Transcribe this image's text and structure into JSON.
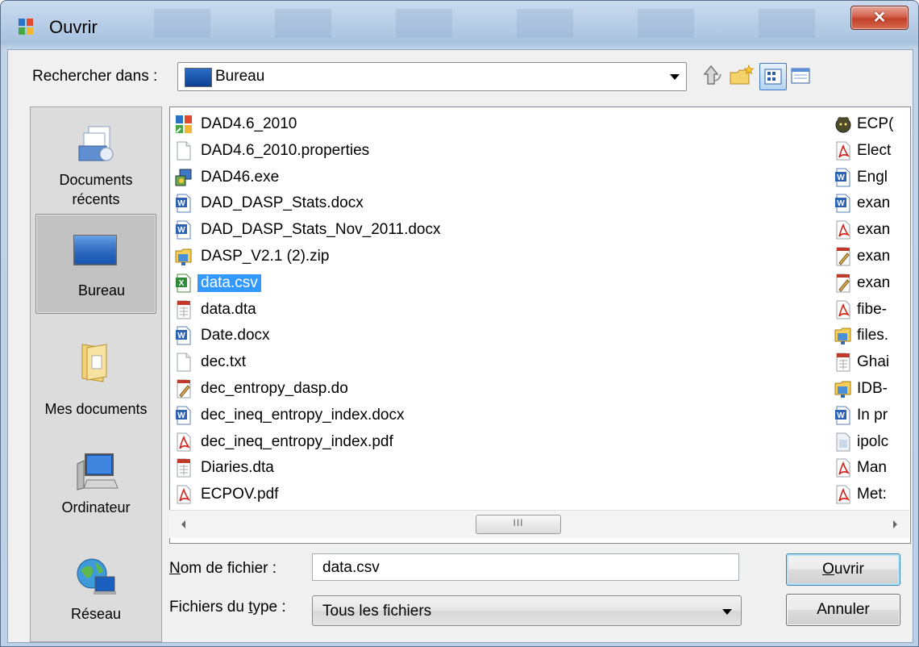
{
  "window": {
    "title": "Ouvrir"
  },
  "toolbar": {
    "look_in_label": "Rechercher dans :",
    "look_in_value": "Bureau"
  },
  "places": [
    {
      "label_line1": "Documents",
      "label_line2": "récents",
      "icon": "recent-documents-icon"
    },
    {
      "label_line1": "Bureau",
      "label_line2": "",
      "icon": "desktop-icon",
      "selected": true
    },
    {
      "label_line1": "Mes documents",
      "label_line2": "",
      "icon": "my-documents-icon"
    },
    {
      "label_line1": "Ordinateur",
      "label_line2": "",
      "icon": "computer-icon"
    },
    {
      "label_line1": "Réseau",
      "label_line2": "",
      "icon": "network-icon"
    }
  ],
  "files_col1": [
    {
      "name": "DAD4.6_2010",
      "icon": "app-shortcut-icon"
    },
    {
      "name": "DAD4.6_2010.properties",
      "icon": "blank-file-icon"
    },
    {
      "name": "DAD46.exe",
      "icon": "exe-icon"
    },
    {
      "name": "DAD_DASP_Stats.docx",
      "icon": "word-icon"
    },
    {
      "name": "DAD_DASP_Stats_Nov_2011.docx",
      "icon": "word-icon"
    },
    {
      "name": "DASP_V2.1 (2).zip",
      "icon": "zip-icon"
    },
    {
      "name": "data.csv",
      "icon": "excel-icon",
      "selected": true
    },
    {
      "name": "data.dta",
      "icon": "dta-icon"
    },
    {
      "name": "Date.docx",
      "icon": "word-icon"
    },
    {
      "name": "dec.txt",
      "icon": "blank-file-icon"
    },
    {
      "name": "dec_entropy_dasp.do",
      "icon": "do-file-icon"
    },
    {
      "name": "dec_ineq_entropy_index.docx",
      "icon": "word-icon"
    },
    {
      "name": "dec_ineq_entropy_index.pdf",
      "icon": "pdf-icon"
    },
    {
      "name": "Diaries.dta",
      "icon": "dta-icon"
    },
    {
      "name": "ECPOV.pdf",
      "icon": "pdf-icon"
    }
  ],
  "files_col2": [
    {
      "name": "ECP(",
      "icon": "game-icon"
    },
    {
      "name": "Elect",
      "icon": "pdf-icon"
    },
    {
      "name": "Engl",
      "icon": "word-icon"
    },
    {
      "name": "exan",
      "icon": "word-icon"
    },
    {
      "name": "exan",
      "icon": "pdf-icon"
    },
    {
      "name": "exan",
      "icon": "do-file-icon"
    },
    {
      "name": "exan",
      "icon": "do-file-icon"
    },
    {
      "name": "fibe-",
      "icon": "pdf-icon"
    },
    {
      "name": "files.",
      "icon": "zip-icon"
    },
    {
      "name": "Ghai",
      "icon": "dta-icon"
    },
    {
      "name": "IDB-",
      "icon": "zip-icon"
    },
    {
      "name": "In pr",
      "icon": "word-icon"
    },
    {
      "name": "ipolc",
      "icon": "generic-file-icon"
    },
    {
      "name": "Man",
      "icon": "pdf-icon"
    },
    {
      "name": "Met:",
      "icon": "pdf-icon"
    }
  ],
  "scrollbar": {
    "thumb_grip": "III"
  },
  "filename": {
    "label_prefix": "N",
    "label_rest": "om de fichier :",
    "value": "data.csv"
  },
  "filetype": {
    "label_prefix": "Fichiers du ",
    "label_u": "t",
    "label_rest": "ype :",
    "value": "Tous les fichiers"
  },
  "buttons": {
    "open_u": "O",
    "open_rest": "uvrir",
    "cancel": "Annuler"
  }
}
